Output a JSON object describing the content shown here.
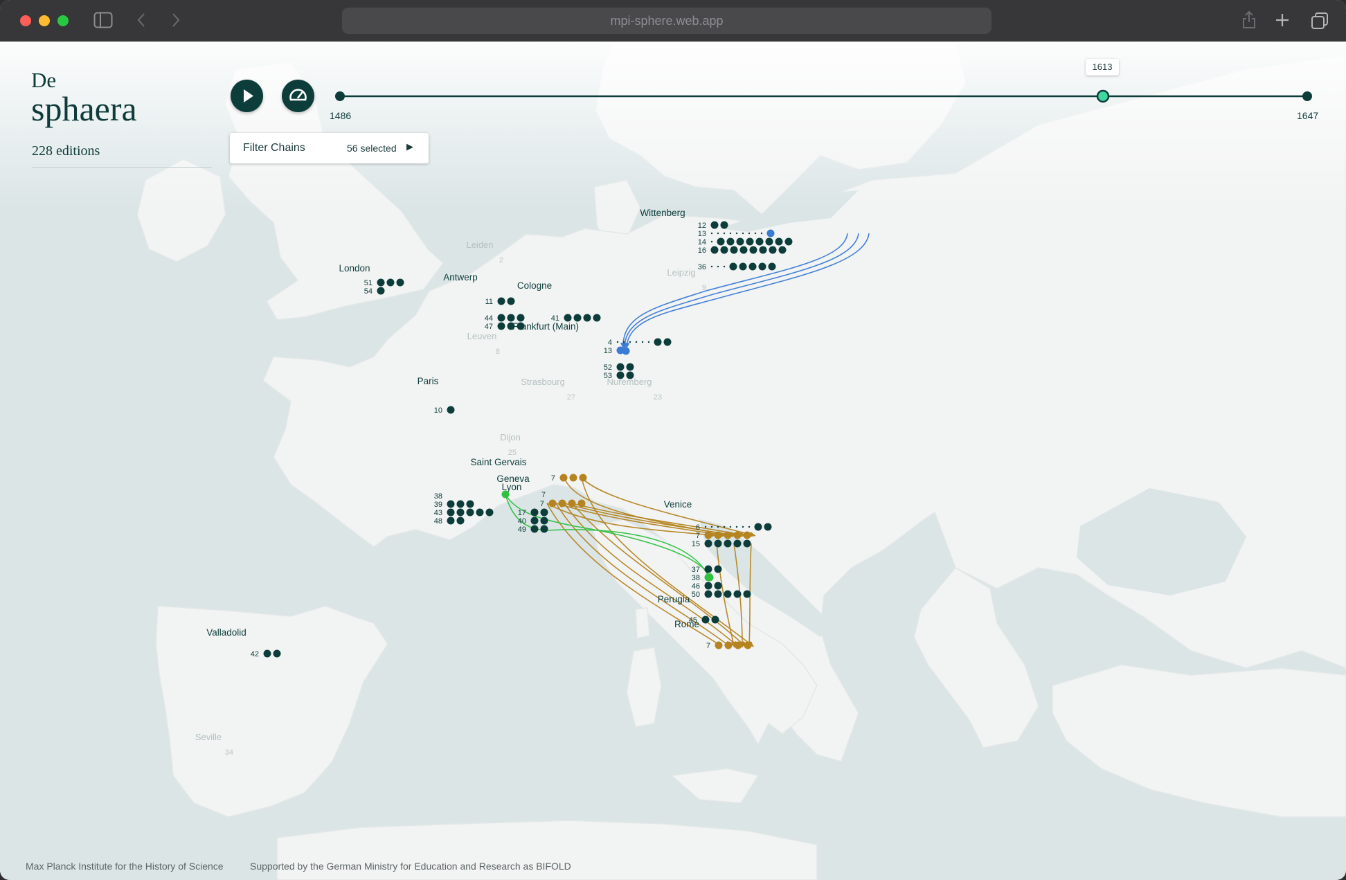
{
  "browser": {
    "url": "mpi-sphere.web.app",
    "sidebar_icon": "sidebar-toggle-icon",
    "back_icon": "chevron-left-icon",
    "forward_icon": "chevron-right-icon",
    "share_icon": "share-icon",
    "new_tab_icon": "plus-icon",
    "tabs_icon": "tabs-overview-icon"
  },
  "app": {
    "title_prefix": "De",
    "title": "sphaera",
    "editions": "228 editions"
  },
  "controls": {
    "play_icon": "play-icon",
    "speed_icon": "speedometer-icon",
    "filter_label": "Filter Chains",
    "filter_selected": "56 selected",
    "filter_arrow": "▶"
  },
  "timeline": {
    "start_label": "1486",
    "end_label": "1647",
    "current_label": "1613",
    "start_year": 1486,
    "end_year": 1647,
    "current_year": 1613
  },
  "colors": {
    "primary": "#0c3d3b",
    "chain_gold": "#b58420",
    "chain_blue": "#3a7bd5",
    "chain_green": "#2fc240",
    "current_marker": "#3fd7a0",
    "sea": "#dbe5e6",
    "land": "#f2f3f3"
  },
  "map": {
    "cities": [
      {
        "name": "Wittenberg",
        "muted": false,
        "rows": [
          {
            "label": "12",
            "dots": 2
          },
          {
            "label": "13",
            "dots": 0
          },
          {
            "label": "14",
            "dots": 8
          },
          {
            "label": "16",
            "dots": 8
          },
          {
            "label": "36",
            "dots": 5
          }
        ]
      },
      {
        "name": "London",
        "muted": false,
        "rows": [
          {
            "label": "51",
            "dots": 3
          },
          {
            "label": "54",
            "dots": 1
          }
        ]
      },
      {
        "name": "Antwerp",
        "muted": false,
        "rows": [
          {
            "label": "11",
            "dots": 2
          },
          {
            "label": "44",
            "dots": 3
          },
          {
            "label": "47",
            "dots": 3
          }
        ]
      },
      {
        "name": "Cologne",
        "muted": false,
        "rows": [
          {
            "label": "41",
            "dots": 4
          }
        ]
      },
      {
        "name": "Frankfurt (Main)",
        "muted": false,
        "rows": [
          {
            "label": "4",
            "dots": 2
          },
          {
            "label": "13",
            "dots": 1
          },
          {
            "label": "52",
            "dots": 2
          },
          {
            "label": "53",
            "dots": 2
          }
        ]
      },
      {
        "name": "Paris",
        "muted": false,
        "rows": [
          {
            "label": "10",
            "dots": 1
          },
          {
            "label": "38",
            "dots": 0
          },
          {
            "label": "39",
            "dots": 3
          },
          {
            "label": "43",
            "dots": 5
          },
          {
            "label": "48",
            "dots": 2
          }
        ]
      },
      {
        "name": "Saint Gervais",
        "muted": false,
        "rows": [
          {
            "label": "7",
            "dots": 3
          }
        ]
      },
      {
        "name": "Geneva",
        "muted": false,
        "rows": [
          {
            "label": "7",
            "dots": 4
          }
        ]
      },
      {
        "name": "Lyon",
        "muted": false,
        "rows": [
          {
            "label": "7",
            "dots": 0
          },
          {
            "label": "17",
            "dots": 2
          },
          {
            "label": "40",
            "dots": 2
          },
          {
            "label": "49",
            "dots": 2
          }
        ]
      },
      {
        "name": "Venice",
        "muted": false,
        "rows": [
          {
            "label": "6",
            "dots": 2
          },
          {
            "label": "7",
            "dots": 5
          },
          {
            "label": "15",
            "dots": 5
          },
          {
            "label": "37",
            "dots": 2
          },
          {
            "label": "38",
            "dots": 1
          },
          {
            "label": "46",
            "dots": 2
          },
          {
            "label": "50",
            "dots": 5
          }
        ]
      },
      {
        "name": "Perugia",
        "muted": false,
        "rows": [
          {
            "label": "45",
            "dots": 2
          }
        ]
      },
      {
        "name": "Rome",
        "muted": false,
        "rows": [
          {
            "label": "7",
            "dots": 4
          }
        ]
      },
      {
        "name": "Valladolid",
        "muted": false,
        "rows": [
          {
            "label": "42",
            "dots": 2
          }
        ]
      },
      {
        "name": "Leiden",
        "muted": true,
        "rows": [
          {
            "label": "2",
            "dots": 0
          }
        ]
      },
      {
        "name": "Leipzig",
        "muted": true,
        "rows": [
          {
            "label": "9",
            "dots": 0
          }
        ]
      },
      {
        "name": "Leuven",
        "muted": true,
        "rows": [
          {
            "label": "8",
            "dots": 0
          }
        ]
      },
      {
        "name": "Strasbourg",
        "muted": true,
        "rows": [
          {
            "label": "27",
            "dots": 0
          }
        ]
      },
      {
        "name": "Nuremberg",
        "muted": true,
        "rows": [
          {
            "label": "23",
            "dots": 0
          }
        ]
      },
      {
        "name": "Dijon",
        "muted": true,
        "rows": [
          {
            "label": "25",
            "dots": 0
          }
        ]
      },
      {
        "name": "Seville",
        "muted": true,
        "rows": [
          {
            "label": "34",
            "dots": 0
          }
        ]
      }
    ],
    "chains": [
      {
        "color": "blue",
        "from": "Wittenberg",
        "to": "Frankfurt (Main)",
        "count": 3
      },
      {
        "color": "gold",
        "from": "Geneva",
        "to": "Venice",
        "count": 6
      },
      {
        "color": "gold",
        "from": "Geneva",
        "to": "Rome",
        "count": 5
      },
      {
        "color": "gold",
        "from": "Venice",
        "to": "Rome",
        "count": 3
      },
      {
        "color": "green",
        "from": "Lyon",
        "to": "Venice",
        "count": 2
      }
    ]
  },
  "footer": {
    "institute": "Max Planck Institute for the History of Science",
    "support": "Supported by the German Ministry for Education and Research as BIFOLD"
  }
}
